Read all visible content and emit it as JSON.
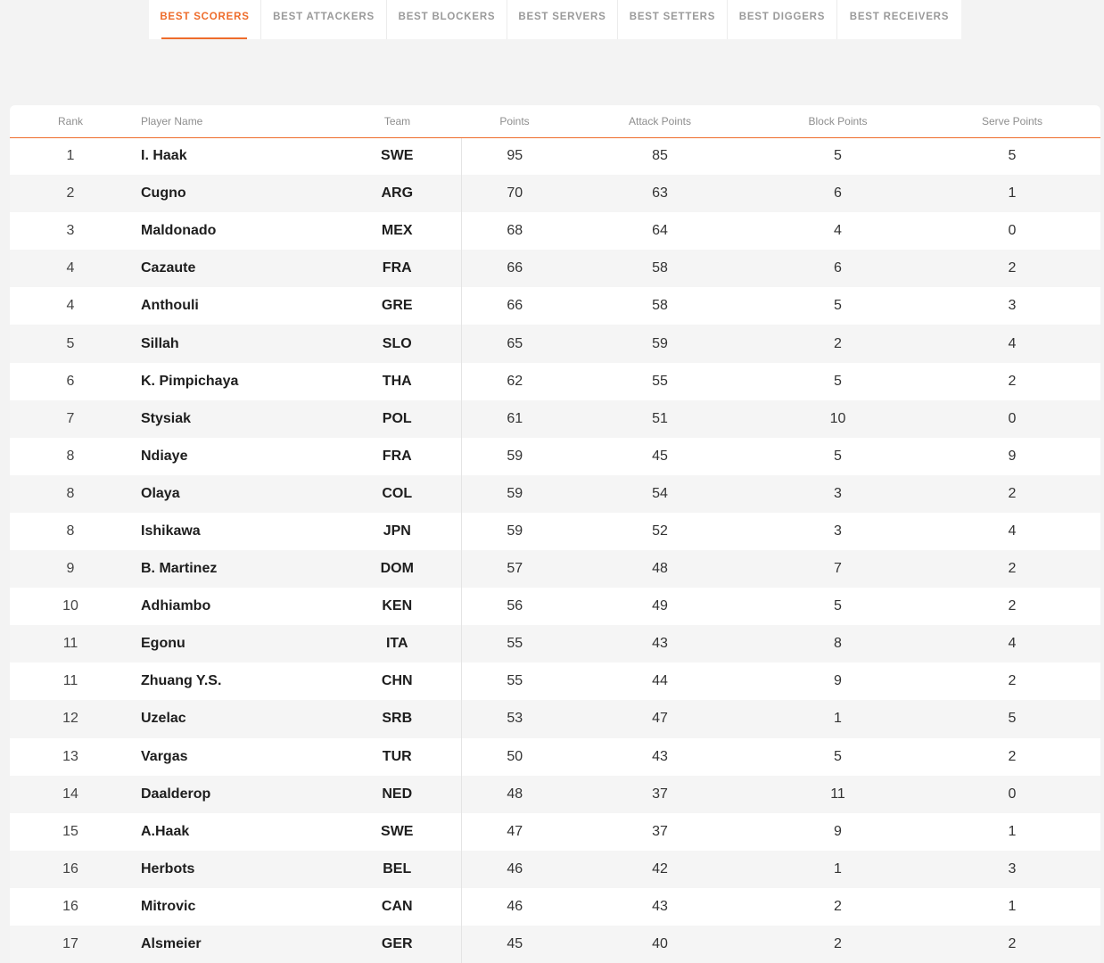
{
  "tabs": [
    {
      "label": "BEST SCORERS",
      "active": true
    },
    {
      "label": "BEST ATTACKERS",
      "active": false
    },
    {
      "label": "BEST BLOCKERS",
      "active": false
    },
    {
      "label": "BEST SERVERS",
      "active": false
    },
    {
      "label": "BEST SETTERS",
      "active": false
    },
    {
      "label": "BEST DIGGERS",
      "active": false
    },
    {
      "label": "BEST RECEIVERS",
      "active": false
    }
  ],
  "accent_color": "#ee6c2b",
  "table": {
    "headers": {
      "rank": "Rank",
      "player": "Player Name",
      "team": "Team",
      "points": "Points",
      "attack": "Attack Points",
      "block": "Block Points",
      "serve": "Serve Points"
    },
    "rows": [
      {
        "rank": "1",
        "player": "I. Haak",
        "team": "SWE",
        "points": "95",
        "attack": "85",
        "block": "5",
        "serve": "5"
      },
      {
        "rank": "2",
        "player": "Cugno",
        "team": "ARG",
        "points": "70",
        "attack": "63",
        "block": "6",
        "serve": "1"
      },
      {
        "rank": "3",
        "player": "Maldonado",
        "team": "MEX",
        "points": "68",
        "attack": "64",
        "block": "4",
        "serve": "0"
      },
      {
        "rank": "4",
        "player": "Cazaute",
        "team": "FRA",
        "points": "66",
        "attack": "58",
        "block": "6",
        "serve": "2"
      },
      {
        "rank": "4",
        "player": "Anthouli",
        "team": "GRE",
        "points": "66",
        "attack": "58",
        "block": "5",
        "serve": "3"
      },
      {
        "rank": "5",
        "player": "Sillah",
        "team": "SLO",
        "points": "65",
        "attack": "59",
        "block": "2",
        "serve": "4"
      },
      {
        "rank": "6",
        "player": "K. Pimpichaya",
        "team": "THA",
        "points": "62",
        "attack": "55",
        "block": "5",
        "serve": "2"
      },
      {
        "rank": "7",
        "player": "Stysiak",
        "team": "POL",
        "points": "61",
        "attack": "51",
        "block": "10",
        "serve": "0"
      },
      {
        "rank": "8",
        "player": "Ndiaye",
        "team": "FRA",
        "points": "59",
        "attack": "45",
        "block": "5",
        "serve": "9"
      },
      {
        "rank": "8",
        "player": "Olaya",
        "team": "COL",
        "points": "59",
        "attack": "54",
        "block": "3",
        "serve": "2"
      },
      {
        "rank": "8",
        "player": "Ishikawa",
        "team": "JPN",
        "points": "59",
        "attack": "52",
        "block": "3",
        "serve": "4"
      },
      {
        "rank": "9",
        "player": "B. Martinez",
        "team": "DOM",
        "points": "57",
        "attack": "48",
        "block": "7",
        "serve": "2"
      },
      {
        "rank": "10",
        "player": "Adhiambo",
        "team": "KEN",
        "points": "56",
        "attack": "49",
        "block": "5",
        "serve": "2"
      },
      {
        "rank": "11",
        "player": "Egonu",
        "team": "ITA",
        "points": "55",
        "attack": "43",
        "block": "8",
        "serve": "4"
      },
      {
        "rank": "11",
        "player": "Zhuang Y.S.",
        "team": "CHN",
        "points": "55",
        "attack": "44",
        "block": "9",
        "serve": "2"
      },
      {
        "rank": "12",
        "player": "Uzelac",
        "team": "SRB",
        "points": "53",
        "attack": "47",
        "block": "1",
        "serve": "5"
      },
      {
        "rank": "13",
        "player": "Vargas",
        "team": "TUR",
        "points": "50",
        "attack": "43",
        "block": "5",
        "serve": "2"
      },
      {
        "rank": "14",
        "player": "Daalderop",
        "team": "NED",
        "points": "48",
        "attack": "37",
        "block": "11",
        "serve": "0"
      },
      {
        "rank": "15",
        "player": "A.Haak",
        "team": "SWE",
        "points": "47",
        "attack": "37",
        "block": "9",
        "serve": "1"
      },
      {
        "rank": "16",
        "player": "Herbots",
        "team": "BEL",
        "points": "46",
        "attack": "42",
        "block": "1",
        "serve": "3"
      },
      {
        "rank": "16",
        "player": "Mitrovic",
        "team": "CAN",
        "points": "46",
        "attack": "43",
        "block": "2",
        "serve": "1"
      },
      {
        "rank": "17",
        "player": "Alsmeier",
        "team": "GER",
        "points": "45",
        "attack": "40",
        "block": "2",
        "serve": "2"
      }
    ]
  }
}
